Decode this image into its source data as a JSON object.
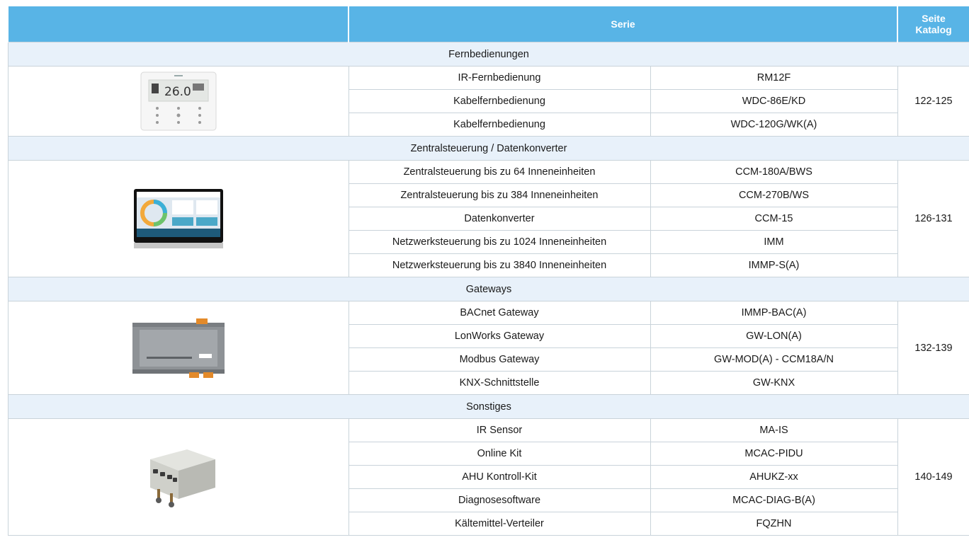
{
  "header": {
    "blank": "",
    "series": "Serie",
    "catalog_line1": "Seite",
    "catalog_line2": "Katalog"
  },
  "sections": [
    {
      "title": "Fernbedienungen",
      "pages": "122-125",
      "image": "wall-remote-controller-image",
      "display_text": "26.0",
      "items": [
        {
          "name": "IR-Fernbedienung",
          "model": "RM12F"
        },
        {
          "name": "Kabelfernbedienung",
          "model": "WDC-86E/KD"
        },
        {
          "name": "Kabelfernbedienung",
          "model": "WDC-120G/WK(A)"
        }
      ]
    },
    {
      "title": "Zentralsteuerung / Datenkonverter",
      "pages": "126-131",
      "image": "touchscreen-central-controller-image",
      "items": [
        {
          "name": "Zentralsteuerung bis zu 64 Inneneinheiten",
          "model": "CCM-180A/BWS"
        },
        {
          "name": "Zentralsteuerung bis zu 384 Inneneinheiten",
          "model": "CCM-270B/WS"
        },
        {
          "name": "Datenkonverter",
          "model": "CCM-15"
        },
        {
          "name": "Netzwerksteuerung bis zu 1024 Inneneinheiten",
          "model": "IMM"
        },
        {
          "name": "Netzwerksteuerung bis zu 3840 Inneneinheiten",
          "model": "IMMP-S(A)"
        }
      ]
    },
    {
      "title": "Gateways",
      "pages": "132-139",
      "image": "din-rail-gateway-image",
      "items": [
        {
          "name": "BACnet Gateway",
          "model": "IMMP-BAC(A)"
        },
        {
          "name": "LonWorks Gateway",
          "model": "GW-LON(A)"
        },
        {
          "name": "Modbus Gateway",
          "model": "GW-MOD(A) - CCM18A/N"
        },
        {
          "name": "KNX-Schnittstelle",
          "model": "GW-KNX"
        }
      ]
    },
    {
      "title": "Sonstiges",
      "pages": "140-149",
      "image": "junction-box-image",
      "items": [
        {
          "name": "IR Sensor",
          "model": "MA-IS"
        },
        {
          "name": "Online Kit",
          "model": "MCAC-PIDU"
        },
        {
          "name": "AHU Kontroll-Kit",
          "model": "AHUKZ-xx"
        },
        {
          "name": "Diagnosesoftware",
          "model": "MCAC-DIAG-B(A)"
        },
        {
          "name": "Kältemittel-Verteiler",
          "model": "FQZHN"
        }
      ]
    }
  ],
  "colors": {
    "header_bg": "#58b4e6",
    "section_bg": "#e8f1fa",
    "grid": "#c9d3da"
  }
}
